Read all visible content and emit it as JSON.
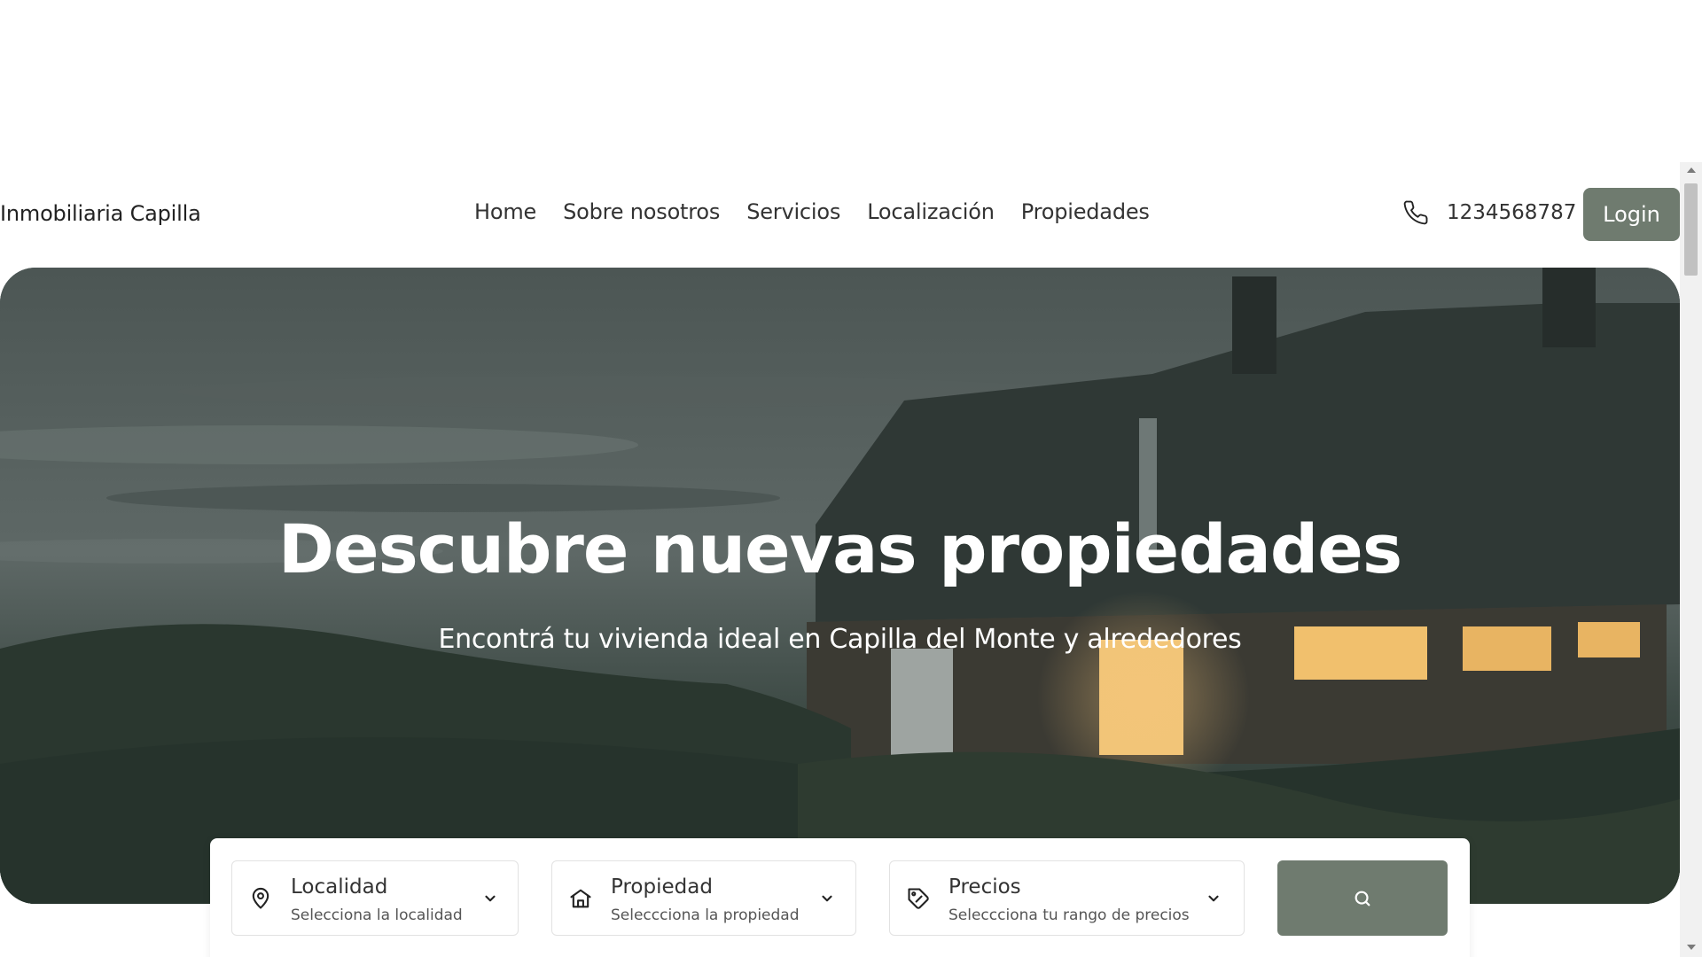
{
  "header": {
    "brand": "Inmobiliaria Capilla",
    "nav": [
      "Home",
      "Sobre nosotros",
      "Servicios",
      "Localización",
      "Propiedades"
    ],
    "phone_icon": "phone-icon",
    "phone": "1234568787",
    "login_label": "Login",
    "accent_color": "#6f7b6f"
  },
  "hero": {
    "title": "Descubre nuevas propiedades",
    "subtitle": "Encontrá tu vivienda ideal en Capilla del Monte y alrededores"
  },
  "search": {
    "fields": [
      {
        "icon": "location-pin-icon",
        "label": "Localidad",
        "placeholder": "Selecciona la localidad"
      },
      {
        "icon": "house-icon",
        "label": "Propiedad",
        "placeholder": "Seleccciona la propiedad"
      },
      {
        "icon": "price-tag-icon",
        "label": "Precios",
        "placeholder": "Seleccciona tu rango de precios"
      }
    ],
    "button_icon": "search-icon"
  }
}
